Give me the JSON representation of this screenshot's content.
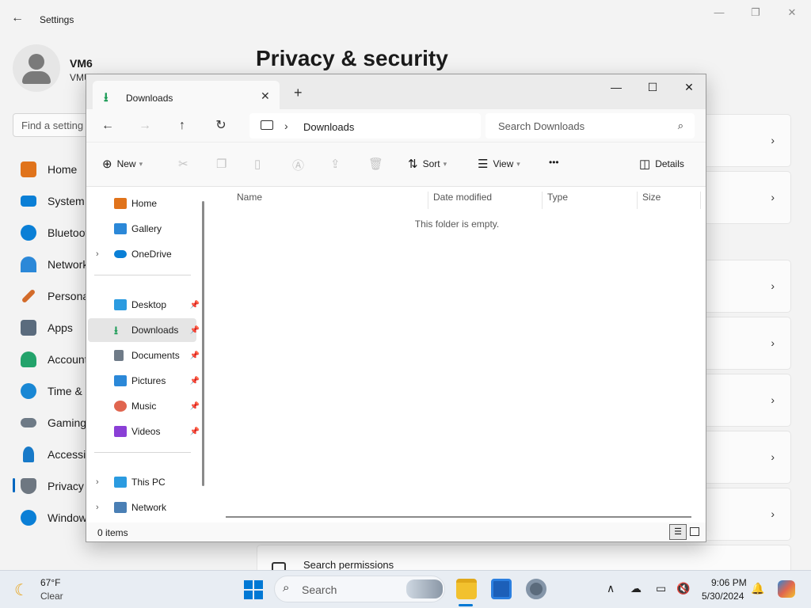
{
  "settings": {
    "title": "Settings",
    "user_name": "VM6",
    "user_sub": "VMU",
    "search_placeholder": "Find a setting",
    "page_title": "Privacy & security",
    "nav": [
      {
        "label": "Home",
        "color": "#e0731b"
      },
      {
        "label": "System",
        "color": "#0a7fd6"
      },
      {
        "label": "Bluetooth & devices",
        "color": "#0a7fd6"
      },
      {
        "label": "Network & internet",
        "color": "#2b88d8"
      },
      {
        "label": "Personalization",
        "color": "#d36b2a"
      },
      {
        "label": "Apps",
        "color": "#5a6b7d"
      },
      {
        "label": "Accounts",
        "color": "#23a36b"
      },
      {
        "label": "Time & language",
        "color": "#1987d4"
      },
      {
        "label": "Gaming",
        "color": "#6e7a86"
      },
      {
        "label": "Accessibility",
        "color": "#1779c8"
      },
      {
        "label": "Privacy & security",
        "color": "#6e7781"
      },
      {
        "label": "Windows Update",
        "color": "#0a7fd6"
      }
    ],
    "search_permissions_label": "Search permissions"
  },
  "explorer": {
    "tab_label": "Downloads",
    "address_path": "Downloads",
    "search_placeholder": "Search Downloads",
    "commands": {
      "new": "New",
      "sort": "Sort",
      "view": "View",
      "more": "•••",
      "details": "Details"
    },
    "nav_items": [
      {
        "label": "Home",
        "icon": "home-icon",
        "color": "#e0731b",
        "expand": false,
        "pinned": false
      },
      {
        "label": "Gallery",
        "icon": "gallery-icon",
        "color": "#2b88d8",
        "expand": false,
        "pinned": false
      },
      {
        "label": "OneDrive",
        "icon": "onedrive-icon",
        "color": "#0a7fd6",
        "expand": true,
        "pinned": false
      },
      {
        "label": "Desktop",
        "icon": "desktop-icon",
        "color": "#2b9be0",
        "expand": false,
        "pinned": true
      },
      {
        "label": "Downloads",
        "icon": "downloads-icon",
        "color": "#1e9c58",
        "expand": false,
        "pinned": true
      },
      {
        "label": "Documents",
        "icon": "documents-icon",
        "color": "#6f7b88",
        "expand": false,
        "pinned": true
      },
      {
        "label": "Pictures",
        "icon": "pictures-icon",
        "color": "#2b88d8",
        "expand": false,
        "pinned": true
      },
      {
        "label": "Music",
        "icon": "music-icon",
        "color": "#e0654f",
        "expand": false,
        "pinned": true
      },
      {
        "label": "Videos",
        "icon": "videos-icon",
        "color": "#8a3fd6",
        "expand": false,
        "pinned": true
      },
      {
        "label": "This PC",
        "icon": "this-pc-icon",
        "color": "#2b9be0",
        "expand": true,
        "pinned": false
      },
      {
        "label": "Network",
        "icon": "network-icon",
        "color": "#4a7fb5",
        "expand": true,
        "pinned": false
      }
    ],
    "columns": [
      "Name",
      "Date modified",
      "Type",
      "Size"
    ],
    "empty_message": "This folder is empty.",
    "status": "0 items"
  },
  "taskbar": {
    "temperature": "67°F",
    "condition": "Clear",
    "search_label": "Search",
    "time": "9:06 PM",
    "date": "5/30/2024"
  }
}
